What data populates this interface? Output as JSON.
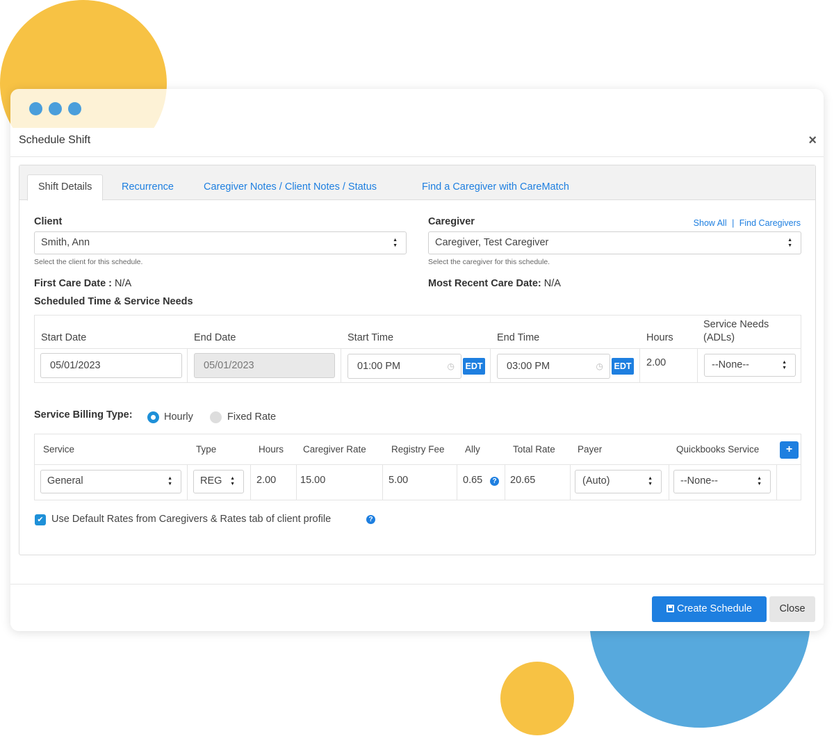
{
  "modal": {
    "title": "Schedule Shift",
    "close_glyph": "×"
  },
  "tabs": [
    {
      "label": "Shift Details",
      "active": true
    },
    {
      "label": "Recurrence",
      "active": false
    },
    {
      "label": "Caregiver Notes / Client Notes / Status",
      "active": false
    },
    {
      "label": "Find a Caregiver with CareMatch",
      "active": false
    }
  ],
  "client": {
    "label": "Client",
    "value": "Smith, Ann",
    "help": "Select the client for this schedule.",
    "first_care_label": "First Care Date :",
    "first_care_value": "N/A"
  },
  "caregiver": {
    "label": "Caregiver",
    "show_all": "Show All",
    "separator": "|",
    "find_caregivers": "Find Caregivers",
    "value": "Caregiver, Test Caregiver",
    "help": "Select the caregiver for this schedule.",
    "recent_care_label": "Most Recent Care Date:",
    "recent_care_value": "N/A"
  },
  "schedule": {
    "section_title": "Scheduled Time & Service Needs",
    "headers": {
      "start_date": "Start Date",
      "end_date": "End Date",
      "start_time": "Start Time",
      "end_time": "End Time",
      "hours": "Hours",
      "service_needs_1": "Service Needs",
      "service_needs_2": "(ADLs)"
    },
    "start_date": "05/01/2023",
    "end_date": "05/01/2023",
    "start_time": "01:00 PM",
    "end_time": "03:00 PM",
    "tz": "EDT",
    "hours": "2.00",
    "service_needs": "--None--"
  },
  "billing": {
    "label": "Service Billing Type:",
    "options": [
      {
        "label": "Hourly",
        "selected": true
      },
      {
        "label": "Fixed Rate",
        "selected": false
      }
    ]
  },
  "service_table": {
    "headers": {
      "service": "Service",
      "type": "Type",
      "hours": "Hours",
      "caregiver_rate": "Caregiver Rate",
      "registry_fee": "Registry Fee",
      "ally": "Ally",
      "total_rate": "Total Rate",
      "payer": "Payer",
      "quickbooks": "Quickbooks Service"
    },
    "add_glyph": "+",
    "row": {
      "service": "General",
      "type": "REG",
      "hours": "2.00",
      "caregiver_rate": "15.00",
      "registry_fee": "5.00",
      "ally": "0.65",
      "total_rate": "20.65",
      "payer": "(Auto)",
      "quickbooks": "--None--"
    }
  },
  "default_rates": {
    "checked": true,
    "label": "Use Default Rates from Caregivers & Rates tab of client profile"
  },
  "footer": {
    "create_label": "Create Schedule",
    "close_label": "Close"
  },
  "colors": {
    "accent": "#1e7fe0",
    "yellow": "#F7C244",
    "blue_blob": "#57A9DD",
    "window_dot": "#4A9EDB"
  }
}
